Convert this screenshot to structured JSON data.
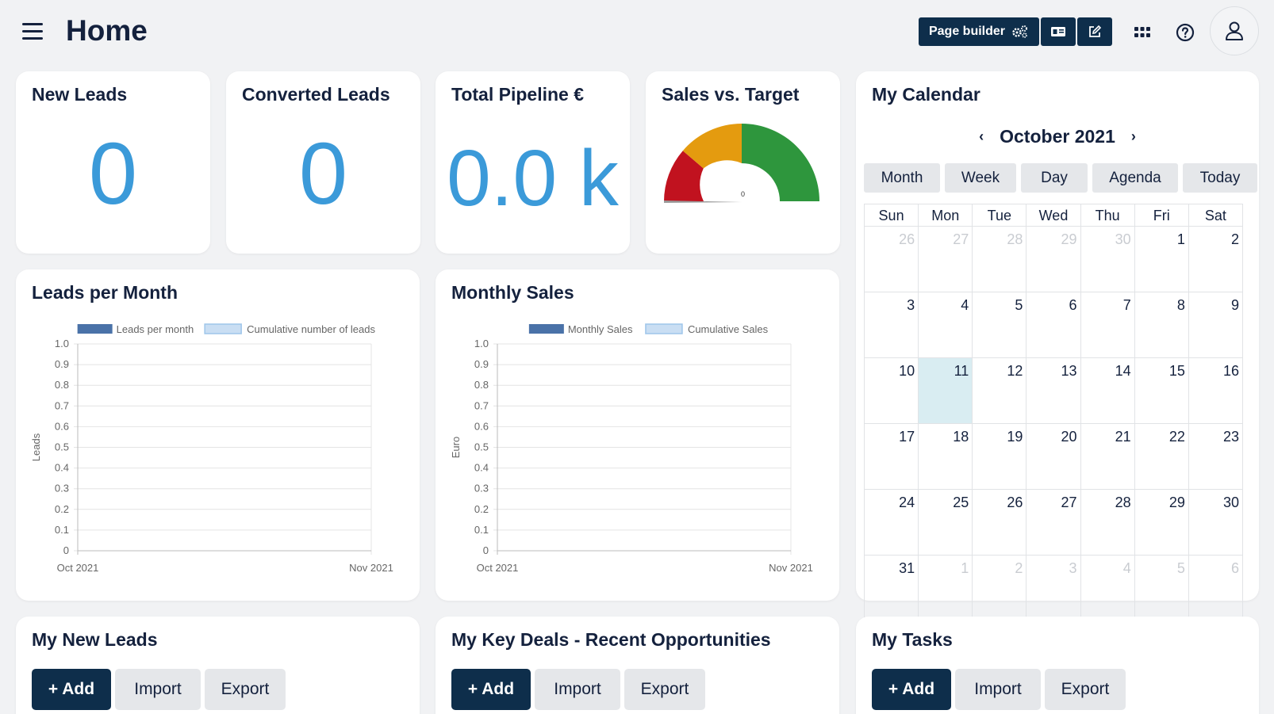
{
  "header": {
    "title": "Home",
    "page_builder_label": "Page builder",
    "icons": [
      "gears-icon",
      "id-card-icon",
      "edit-icon",
      "apps-grid-icon",
      "help-icon",
      "user-icon"
    ]
  },
  "kpis": {
    "new_leads": {
      "title": "New Leads",
      "value": "0"
    },
    "converted_leads": {
      "title": "Converted Leads",
      "value": "0"
    },
    "total_pipeline": {
      "title": "Total Pipeline €",
      "value": "0.0 k"
    },
    "sales_vs_target": {
      "title": "Sales vs. Target",
      "value": "0"
    }
  },
  "colors": {
    "accent": "#3b9ad9",
    "navy": "#0e2e4b",
    "gauge_red": "#c1121f",
    "gauge_orange": "#e49b0f",
    "gauge_green": "#2e963d",
    "bar_dark": "#4a72a8",
    "bar_light": "#c9def3"
  },
  "calendar": {
    "title": "My Calendar",
    "month_label": "October 2021",
    "prev": "‹",
    "next": "›",
    "views": [
      "Month",
      "Week",
      "Day",
      "Agenda",
      "Today"
    ],
    "weekdays": [
      "Sun",
      "Mon",
      "Tue",
      "Wed",
      "Thu",
      "Fri",
      "Sat"
    ],
    "weeks": [
      [
        {
          "d": "26",
          "o": true
        },
        {
          "d": "27",
          "o": true
        },
        {
          "d": "28",
          "o": true
        },
        {
          "d": "29",
          "o": true
        },
        {
          "d": "30",
          "o": true
        },
        {
          "d": "1"
        },
        {
          "d": "2"
        }
      ],
      [
        {
          "d": "3"
        },
        {
          "d": "4"
        },
        {
          "d": "5"
        },
        {
          "d": "6"
        },
        {
          "d": "7"
        },
        {
          "d": "8"
        },
        {
          "d": "9"
        }
      ],
      [
        {
          "d": "10"
        },
        {
          "d": "11",
          "t": true
        },
        {
          "d": "12"
        },
        {
          "d": "13"
        },
        {
          "d": "14"
        },
        {
          "d": "15"
        },
        {
          "d": "16"
        }
      ],
      [
        {
          "d": "17"
        },
        {
          "d": "18"
        },
        {
          "d": "19"
        },
        {
          "d": "20"
        },
        {
          "d": "21"
        },
        {
          "d": "22"
        },
        {
          "d": "23"
        }
      ],
      [
        {
          "d": "24"
        },
        {
          "d": "25"
        },
        {
          "d": "26"
        },
        {
          "d": "27"
        },
        {
          "d": "28"
        },
        {
          "d": "29"
        },
        {
          "d": "30"
        }
      ],
      [
        {
          "d": "31"
        },
        {
          "d": "1",
          "o": true
        },
        {
          "d": "2",
          "o": true
        },
        {
          "d": "3",
          "o": true
        },
        {
          "d": "4",
          "o": true
        },
        {
          "d": "5",
          "o": true
        },
        {
          "d": "6",
          "o": true
        }
      ]
    ]
  },
  "chart_data": [
    {
      "type": "bar",
      "title": "Leads per Month",
      "ylabel": "Leads",
      "xlabel": "",
      "categories": [
        "Oct 2021",
        "Nov 2021"
      ],
      "series": [
        {
          "name": "Leads per month",
          "values": [
            0,
            0
          ]
        },
        {
          "name": "Cumulative number of leads",
          "values": [
            0,
            0
          ]
        }
      ],
      "ylim": [
        0,
        1.0
      ],
      "yticks": [
        "1.0",
        "0.9",
        "0.8",
        "0.7",
        "0.6",
        "0.5",
        "0.4",
        "0.3",
        "0.2",
        "0.1",
        "0"
      ],
      "grid": true,
      "legend": "top"
    },
    {
      "type": "bar",
      "title": "Monthly Sales",
      "ylabel": "Euro",
      "xlabel": "",
      "categories": [
        "Oct 2021",
        "Nov 2021"
      ],
      "series": [
        {
          "name": "Monthly Sales",
          "values": [
            0,
            0
          ]
        },
        {
          "name": "Cumulative Sales",
          "values": [
            0,
            0
          ]
        }
      ],
      "ylim": [
        0,
        1.0
      ],
      "yticks": [
        "1.0",
        "0.9",
        "0.8",
        "0.7",
        "0.6",
        "0.5",
        "0.4",
        "0.3",
        "0.2",
        "0.1",
        "0"
      ],
      "grid": true,
      "legend": "top"
    }
  ],
  "bottom_cards": [
    {
      "title": "My New Leads",
      "add": "+ Add",
      "import": "Import",
      "export": "Export"
    },
    {
      "title": "My Key Deals - Recent Opportunities",
      "add": "+ Add",
      "import": "Import",
      "export": "Export"
    },
    {
      "title": "My Tasks",
      "add": "+ Add",
      "import": "Import",
      "export": "Export"
    }
  ]
}
